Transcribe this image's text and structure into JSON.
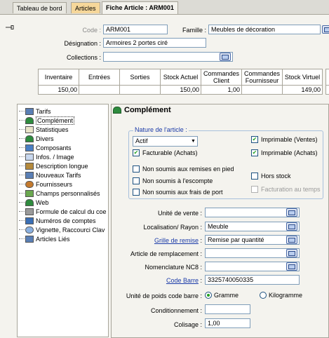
{
  "tabs": [
    "Tableau de bord",
    "Articles",
    "Fiche Article : ARM001"
  ],
  "header": {
    "code_label": "Code :",
    "code_value": "ARM001",
    "famille_label": "Famille :",
    "famille_value": "Meubles de décoration",
    "designation_label": "Désignation :",
    "designation_value": "Armoires 2 portes ciré",
    "collections_label": "Collections :",
    "collections_value": ""
  },
  "stats": {
    "headers": [
      "Inventaire",
      "Entrées",
      "Sorties",
      "Stock Actuel",
      "Commandes Client",
      "Commandes Fournisseur",
      "Stock Virtuel"
    ],
    "values": [
      "150,00",
      "",
      "",
      "150,00",
      "1,00",
      "",
      "149,00"
    ]
  },
  "tree": {
    "items": [
      "Tarifs",
      "Complément",
      "Statistiques",
      "Divers",
      "Composants",
      "Infos. / Image",
      "Description longue",
      "Nouveaux Tarifs",
      "Fournisseurs",
      "Champs personnalisés",
      "Web",
      "Formule de calcul du coe",
      "Numéros de comptes",
      "Vignette, Raccourci Clav",
      "Articles Liés"
    ],
    "selected": "Complément"
  },
  "panel": {
    "title": "Complément",
    "nature_legend": "Nature de l'article :",
    "nature_value": "Actif",
    "checks": {
      "facturable": {
        "label": "Facturable (Achats)",
        "checked": true
      },
      "imprimable_ventes": {
        "label": "Imprimable (Ventes)",
        "checked": true
      },
      "imprimable_achats": {
        "label": "Imprimable (Achats)",
        "checked": true
      },
      "remises_pied": {
        "label": "Non soumis aux remises en pied",
        "checked": false
      },
      "escompte": {
        "label": "Non soumis à l'escompte",
        "checked": false
      },
      "frais_port": {
        "label": "Non soumis aux frais de port",
        "checked": false
      },
      "hors_stock": {
        "label": "Hors stock",
        "checked": false
      },
      "facturation_temps": {
        "label": "Facturation au temps",
        "checked": false
      }
    },
    "fields": {
      "unite_vente": {
        "label": "Unité de vente :",
        "value": ""
      },
      "localisation": {
        "label": "Localisation/ Rayon :",
        "value": "Meuble"
      },
      "grille_remise": {
        "label": "Grille de remise",
        "value": "Remise par quantité"
      },
      "article_remplacement": {
        "label": "Article de remplacement :",
        "value": ""
      },
      "nc8": {
        "label": "Nomenclature NC8 :",
        "value": ""
      },
      "code_barre": {
        "label": "Code Barre",
        "value": "3325740050335"
      },
      "poids_label": "Unité de poids code barre :",
      "gramme": "Gramme",
      "kilogramme": "Kilogramme",
      "conditionnement": {
        "label": "Conditionnement :",
        "value": ""
      },
      "colisage": {
        "label": "Colisage :",
        "value": "1,00"
      }
    }
  }
}
